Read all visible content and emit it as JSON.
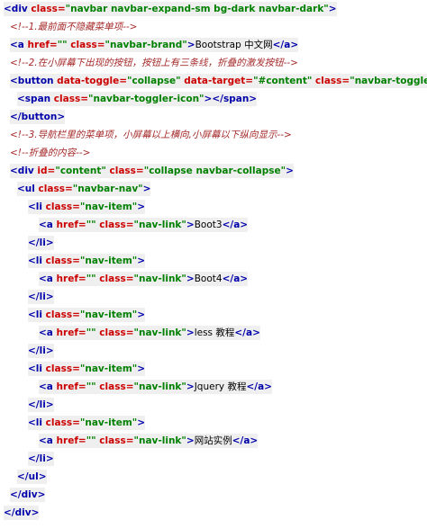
{
  "code_lines": [
    {
      "indent": 0,
      "tokens": [
        {
          "t": "tag",
          "v": "<div "
        },
        {
          "t": "attr",
          "v": "class="
        },
        {
          "t": "val",
          "v": "\"navbar navbar-expand-sm bg-dark navbar-dark\""
        },
        {
          "t": "tag",
          "v": ">"
        }
      ]
    },
    {
      "indent": 1,
      "tokens": [
        {
          "t": "comment",
          "v": "<!--1.最前面不隐藏菜单项-->"
        }
      ]
    },
    {
      "indent": 1,
      "tokens": [
        {
          "t": "tag",
          "v": "<a "
        },
        {
          "t": "attr",
          "v": "href="
        },
        {
          "t": "val",
          "v": "\"\""
        },
        {
          "t": "attr",
          "v": " class="
        },
        {
          "t": "val",
          "v": "\"navbar-brand\""
        },
        {
          "t": "tag",
          "v": ">"
        },
        {
          "t": "txt",
          "v": "Bootstrap 中文网"
        },
        {
          "t": "tag",
          "v": "</a>"
        }
      ]
    },
    {
      "indent": 1,
      "tokens": [
        {
          "t": "comment",
          "v": "<!--2.在小屏幕下出现的按钮，按钮上有三条线，折叠的激发按钮-->"
        }
      ]
    },
    {
      "indent": 1,
      "tokens": [
        {
          "t": "tag",
          "v": "<button "
        },
        {
          "t": "attr",
          "v": "data-toggle="
        },
        {
          "t": "val",
          "v": "\"collapse\""
        },
        {
          "t": "attr",
          "v": " data-target="
        },
        {
          "t": "val",
          "v": "\"#content\""
        },
        {
          "t": "attr",
          "v": " class="
        },
        {
          "t": "val",
          "v": "\"navbar-toggler\""
        },
        {
          "t": "tag",
          "v": ">"
        }
      ]
    },
    {
      "indent": 2,
      "tokens": [
        {
          "t": "tag",
          "v": "<span "
        },
        {
          "t": "attr",
          "v": "class="
        },
        {
          "t": "val",
          "v": "\"navbar-toggler-icon\""
        },
        {
          "t": "tag",
          "v": "></span>"
        }
      ]
    },
    {
      "indent": 1,
      "tokens": [
        {
          "t": "tag",
          "v": "</button>"
        }
      ]
    },
    {
      "indent": 1,
      "tokens": [
        {
          "t": "comment",
          "v": "<!--3.导航栏里的菜单项，小屏幕以上横向,小屏幕以下纵向显示-->"
        }
      ]
    },
    {
      "indent": 1,
      "tokens": [
        {
          "t": "comment",
          "v": "<!--折叠的内容-->"
        }
      ]
    },
    {
      "indent": 1,
      "tokens": [
        {
          "t": "tag",
          "v": "<div "
        },
        {
          "t": "attr",
          "v": "id="
        },
        {
          "t": "val",
          "v": "\"content\""
        },
        {
          "t": "attr",
          "v": " class="
        },
        {
          "t": "val",
          "v": "\"collapse navbar-collapse\""
        },
        {
          "t": "tag",
          "v": ">"
        }
      ]
    },
    {
      "indent": 2,
      "tokens": [
        {
          "t": "tag",
          "v": "<ul "
        },
        {
          "t": "attr",
          "v": "class="
        },
        {
          "t": "val",
          "v": "\"navbar-nav\""
        },
        {
          "t": "tag",
          "v": ">"
        }
      ]
    },
    {
      "indent": 3,
      "tokens": [
        {
          "t": "tag",
          "v": "<li "
        },
        {
          "t": "attr",
          "v": "class="
        },
        {
          "t": "val",
          "v": "\"nav-item\""
        },
        {
          "t": "tag",
          "v": ">"
        }
      ]
    },
    {
      "indent": 4,
      "tokens": [
        {
          "t": "tag",
          "v": "<a "
        },
        {
          "t": "attr",
          "v": "href="
        },
        {
          "t": "val",
          "v": "\"\""
        },
        {
          "t": "attr",
          "v": " class="
        },
        {
          "t": "val",
          "v": "\"nav-link\""
        },
        {
          "t": "tag",
          "v": ">"
        },
        {
          "t": "txt",
          "v": "Boot3"
        },
        {
          "t": "tag",
          "v": "</a>"
        }
      ]
    },
    {
      "indent": 3,
      "tokens": [
        {
          "t": "tag",
          "v": "</li>"
        }
      ]
    },
    {
      "indent": 3,
      "tokens": [
        {
          "t": "tag",
          "v": "<li "
        },
        {
          "t": "attr",
          "v": "class="
        },
        {
          "t": "val",
          "v": "\"nav-item\""
        },
        {
          "t": "tag",
          "v": ">"
        }
      ]
    },
    {
      "indent": 4,
      "tokens": [
        {
          "t": "tag",
          "v": "<a "
        },
        {
          "t": "attr",
          "v": "href="
        },
        {
          "t": "val",
          "v": "\"\""
        },
        {
          "t": "attr",
          "v": " class="
        },
        {
          "t": "val",
          "v": "\"nav-link\""
        },
        {
          "t": "tag",
          "v": ">"
        },
        {
          "t": "txt",
          "v": "Boot4"
        },
        {
          "t": "tag",
          "v": "</a>"
        }
      ]
    },
    {
      "indent": 3,
      "tokens": [
        {
          "t": "tag",
          "v": "</li>"
        }
      ]
    },
    {
      "indent": 3,
      "tokens": [
        {
          "t": "tag",
          "v": "<li "
        },
        {
          "t": "attr",
          "v": "class="
        },
        {
          "t": "val",
          "v": "\"nav-item\""
        },
        {
          "t": "tag",
          "v": ">"
        }
      ]
    },
    {
      "indent": 4,
      "tokens": [
        {
          "t": "tag",
          "v": "<a "
        },
        {
          "t": "attr",
          "v": "href="
        },
        {
          "t": "val",
          "v": "\"\""
        },
        {
          "t": "attr",
          "v": " class="
        },
        {
          "t": "val",
          "v": "\"nav-link\""
        },
        {
          "t": "tag",
          "v": ">"
        },
        {
          "t": "txt",
          "v": "less 教程"
        },
        {
          "t": "tag",
          "v": "</a>"
        }
      ]
    },
    {
      "indent": 3,
      "tokens": [
        {
          "t": "tag",
          "v": "</li>"
        }
      ]
    },
    {
      "indent": 3,
      "tokens": [
        {
          "t": "tag",
          "v": "<li "
        },
        {
          "t": "attr",
          "v": "class="
        },
        {
          "t": "val",
          "v": "\"nav-item\""
        },
        {
          "t": "tag",
          "v": ">"
        }
      ]
    },
    {
      "indent": 4,
      "tokens": [
        {
          "t": "tag",
          "v": "<a "
        },
        {
          "t": "attr",
          "v": "href="
        },
        {
          "t": "val",
          "v": "\"\""
        },
        {
          "t": "attr",
          "v": " class="
        },
        {
          "t": "val",
          "v": "\"nav-link\""
        },
        {
          "t": "tag",
          "v": ">"
        },
        {
          "t": "txt",
          "v": "Jquery 教程"
        },
        {
          "t": "tag",
          "v": "</a>"
        }
      ]
    },
    {
      "indent": 3,
      "tokens": [
        {
          "t": "tag",
          "v": "</li>"
        }
      ]
    },
    {
      "indent": 3,
      "tokens": [
        {
          "t": "tag",
          "v": "<li "
        },
        {
          "t": "attr",
          "v": "class="
        },
        {
          "t": "val",
          "v": "\"nav-item\""
        },
        {
          "t": "tag",
          "v": ">"
        }
      ]
    },
    {
      "indent": 4,
      "tokens": [
        {
          "t": "tag",
          "v": "<a "
        },
        {
          "t": "attr",
          "v": "href="
        },
        {
          "t": "val",
          "v": "\"\""
        },
        {
          "t": "attr",
          "v": " class="
        },
        {
          "t": "val",
          "v": "\"nav-link\""
        },
        {
          "t": "tag",
          "v": ">"
        },
        {
          "t": "txt",
          "v": "网站实例"
        },
        {
          "t": "tag",
          "v": "</a>"
        }
      ]
    },
    {
      "indent": 3,
      "tokens": [
        {
          "t": "tag",
          "v": "</li>"
        }
      ]
    },
    {
      "indent": 2,
      "tokens": [
        {
          "t": "tag",
          "v": "</ul>"
        }
      ]
    },
    {
      "indent": 1,
      "tokens": [
        {
          "t": "tag",
          "v": "</div>"
        }
      ]
    },
    {
      "indent": 0,
      "tokens": [
        {
          "t": "tag",
          "v": "</div>"
        }
      ]
    }
  ]
}
